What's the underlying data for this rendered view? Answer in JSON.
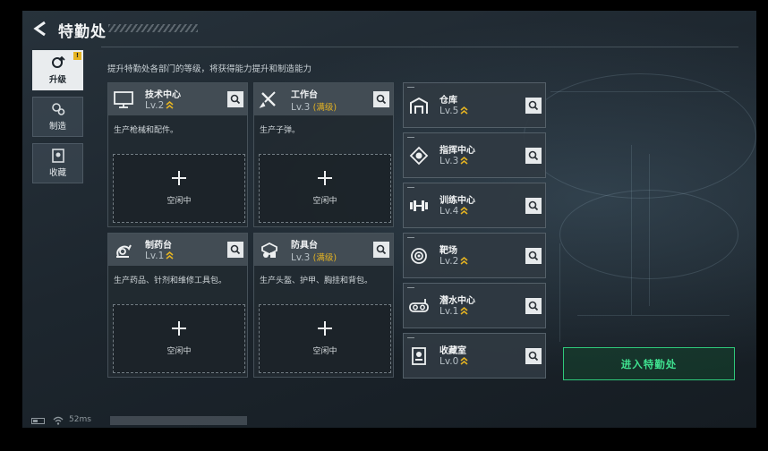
{
  "header": {
    "title": "特勤处"
  },
  "subtitle": "提升特勤处各部门的等级，将获得能力提升和制造能力",
  "nav": [
    {
      "label": "升级",
      "active": true,
      "badge": "!"
    },
    {
      "label": "制造",
      "active": false
    },
    {
      "label": "收藏",
      "active": false
    }
  ],
  "big_cards": [
    {
      "name": "技术中心",
      "level": "Lv.2",
      "max": "",
      "desc": "生产枪械和配件。",
      "slot": "空闲中",
      "icon": "computer-icon"
    },
    {
      "name": "工作台",
      "level": "Lv.3",
      "max": "(满级)",
      "desc": "生产子弹。",
      "slot": "空闲中",
      "icon": "tools-icon"
    },
    {
      "name": "制药台",
      "level": "Lv.1",
      "max": "",
      "desc": "生产药品、针剂和维修工具包。",
      "slot": "空闲中",
      "icon": "flask-icon"
    },
    {
      "name": "防具台",
      "level": "Lv.3",
      "max": "(满级)",
      "desc": "生产头盔、护甲、胸挂和背包。",
      "slot": "空闲中",
      "icon": "armor-icon"
    }
  ],
  "small_cards": [
    {
      "name": "仓库",
      "level": "Lv.5",
      "icon": "warehouse-icon"
    },
    {
      "name": "指挥中心",
      "level": "Lv.3",
      "icon": "command-icon"
    },
    {
      "name": "训练中心",
      "level": "Lv.4",
      "icon": "dumbbell-icon"
    },
    {
      "name": "靶场",
      "level": "Lv.2",
      "icon": "target-icon"
    },
    {
      "name": "潜水中心",
      "level": "Lv.1",
      "icon": "diving-mask-icon"
    },
    {
      "name": "收藏室",
      "level": "Lv.0",
      "icon": "collection-icon"
    }
  ],
  "enter_button": "进入特勤处",
  "status": {
    "ping": "52ms"
  },
  "colors": {
    "accent_green": "#2fc97b",
    "max_level_gold": "#e6b422",
    "upgrade_arrow": "#e6b422"
  }
}
